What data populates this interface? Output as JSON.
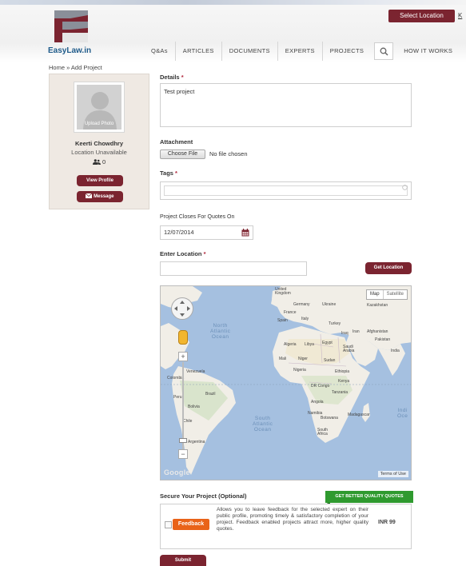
{
  "header": {
    "logo_text": "EasyLaw.in",
    "select_location_label": "Select Location",
    "k_link": "K",
    "nav": [
      "Q&As",
      "ARTICLES",
      "DOCUMENTS",
      "EXPERTS",
      "PROJECTS",
      "HOW IT WORKS"
    ]
  },
  "breadcrumb": "Home » Add Project",
  "profile": {
    "upload_photo": "Upload Photo",
    "name": "Keerti Chowdhry",
    "location": "Location Unavailable",
    "count": "0",
    "view_profile": "View Profile",
    "message": "Message"
  },
  "form": {
    "details_label": "Details",
    "required_mark": "*",
    "details_value": "Test project",
    "attachment_label": "Attachment",
    "choose_file": "Choose File",
    "no_file": "No file chosen",
    "tags_label": "Tags",
    "tags_value": "",
    "closes_label": "Project Closes For Quotes On",
    "closes_value": "12/07/2014",
    "location_label": "Enter Location",
    "location_value": "",
    "get_location": "Get Location"
  },
  "map": {
    "map_label": "Map",
    "satellite_label": "Satellite",
    "google": "Google",
    "terms": "Terms of Use",
    "ocean_north": "North\nAtlantic\nOcean",
    "ocean_south": "South\nAtlantic\nOcean",
    "ocean_indian": "Indi\nOce",
    "places": [
      {
        "id": "kingdom",
        "text": "United\nKingdom"
      },
      {
        "id": "germany",
        "text": "Germany"
      },
      {
        "id": "ukraine",
        "text": "Ukraine"
      },
      {
        "id": "kazakhstan",
        "text": "Kazakhstan"
      },
      {
        "id": "france",
        "text": "France"
      },
      {
        "id": "spain",
        "text": "Spain"
      },
      {
        "id": "italy",
        "text": "Italy"
      },
      {
        "id": "turkey",
        "text": "Turkey"
      },
      {
        "id": "iran",
        "text": "Iran"
      },
      {
        "id": "iraq",
        "text": "Iraq"
      },
      {
        "id": "afghanistan",
        "text": "Afghanistan"
      },
      {
        "id": "pakistan",
        "text": "Pakistan"
      },
      {
        "id": "india",
        "text": "India"
      },
      {
        "id": "algeria",
        "text": "Algeria"
      },
      {
        "id": "libya",
        "text": "Libya"
      },
      {
        "id": "egypt",
        "text": "Egypt"
      },
      {
        "id": "saudi",
        "text": "Saudi\nArabia"
      },
      {
        "id": "mali",
        "text": "Mali"
      },
      {
        "id": "niger",
        "text": "Niger"
      },
      {
        "id": "sudan",
        "text": "Sudan"
      },
      {
        "id": "nigeria",
        "text": "Nigeria"
      },
      {
        "id": "ethiopia",
        "text": "Ethiopia"
      },
      {
        "id": "kenya",
        "text": "Kenya"
      },
      {
        "id": "drcongo",
        "text": "DR Congo"
      },
      {
        "id": "tanzania",
        "text": "Tanzania"
      },
      {
        "id": "angola",
        "text": "Angola"
      },
      {
        "id": "namibia",
        "text": "Namibia"
      },
      {
        "id": "botswana",
        "text": "Botswana"
      },
      {
        "id": "madagascar",
        "text": "Madagascar"
      },
      {
        "id": "southafrica",
        "text": "South\nAfrica"
      },
      {
        "id": "venezuela",
        "text": "Venezuela"
      },
      {
        "id": "colombia",
        "text": "Colombia"
      },
      {
        "id": "brazil",
        "text": "Brazil"
      },
      {
        "id": "peru",
        "text": "Peru"
      },
      {
        "id": "bolivia",
        "text": "Bolivia"
      },
      {
        "id": "chile",
        "text": "Chile"
      },
      {
        "id": "argentina",
        "text": "Argentina"
      }
    ]
  },
  "secure": {
    "title": "Secure Your Project (Optional)",
    "banner": "GET BETTER QUALITY QUOTES",
    "badge": "Feedback",
    "description": "Allows you to leave feedback for the selected expert on their public profile, promoting timely & satisfactory completion of your project. Feedback enabled projects attract more, higher quality quotes.",
    "price": "INR 99"
  },
  "submit": "Submit",
  "colors": {
    "brand": "#7b2430",
    "accent_green": "#2f9a2f",
    "feedback_orange": "#e96319",
    "ocean": "#a5c0e0"
  }
}
